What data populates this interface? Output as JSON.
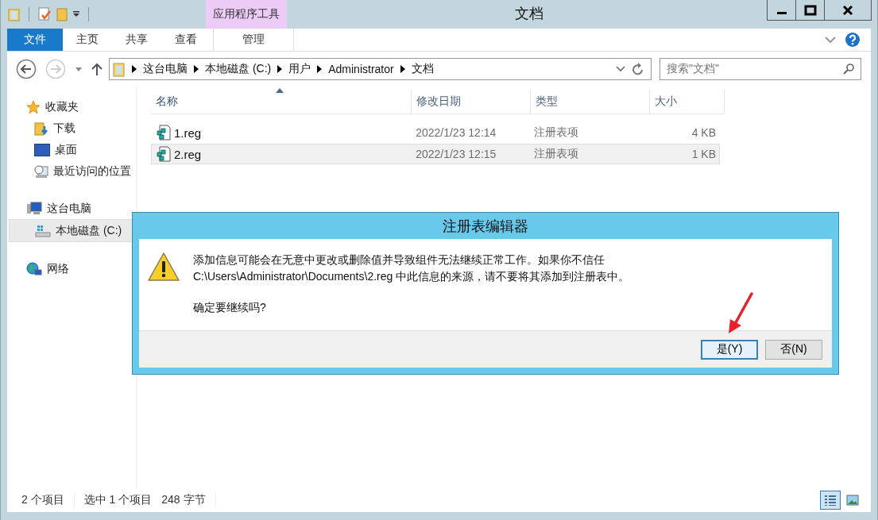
{
  "window": {
    "title": "文档",
    "context_group": "应用程序工具"
  },
  "ribbon": {
    "tabs": [
      {
        "label": "文件",
        "kind": "file"
      },
      {
        "label": "主页",
        "kind": "tab"
      },
      {
        "label": "共享",
        "kind": "tab"
      },
      {
        "label": "查看",
        "kind": "tab"
      },
      {
        "label": "管理",
        "kind": "context"
      }
    ]
  },
  "address": {
    "path": [
      "这台电脑",
      "本地磁盘 (C:)",
      "用户",
      "Administrator",
      "文档"
    ],
    "search_placeholder": "搜索\"文档\""
  },
  "sidebar": {
    "groups": [
      {
        "label": "收藏夹",
        "kind": "favorites",
        "selected": false,
        "children": [
          {
            "label": "下载",
            "kind": "downloads",
            "selected": false
          },
          {
            "label": "桌面",
            "kind": "desktop",
            "selected": false
          },
          {
            "label": "最近访问的位置",
            "kind": "recent",
            "selected": false
          }
        ]
      },
      {
        "label": "这台电脑",
        "kind": "computer",
        "selected": false,
        "children": [
          {
            "label": "本地磁盘 (C:)",
            "kind": "drive",
            "selected": true
          }
        ]
      },
      {
        "label": "网络",
        "kind": "network",
        "selected": false
      }
    ]
  },
  "table": {
    "columns": [
      {
        "label": "名称",
        "sorted": true
      },
      {
        "label": "修改日期",
        "sorted": false
      },
      {
        "label": "类型",
        "sorted": false
      },
      {
        "label": "大小",
        "sorted": false
      }
    ],
    "rows": [
      {
        "name": "1.reg",
        "modified": "2022/1/23 12:14",
        "type": "注册表项",
        "size": "4 KB",
        "selected": false
      },
      {
        "name": "2.reg",
        "modified": "2022/1/23 12:15",
        "type": "注册表项",
        "size": "1 KB",
        "selected": true
      }
    ]
  },
  "dialog": {
    "title": "注册表编辑器",
    "message": "添加信息可能会在无意中更改或删除值并导致组件无法继续正常工作。如果你不信任 C:\\Users\\Administrator\\Documents\\2.reg 中此信息的来源，请不要将其添加到注册表中。",
    "question": "确定要继续吗?",
    "buttons": [
      {
        "label": "是(Y)",
        "default": true
      },
      {
        "label": "否(N)",
        "default": false
      }
    ]
  },
  "status_bar": {
    "items": [
      "2 个项目",
      "选中 1 个项目",
      "248 字节"
    ],
    "views": [
      {
        "kind": "details",
        "selected": true
      },
      {
        "kind": "large-icons",
        "selected": false
      }
    ]
  }
}
